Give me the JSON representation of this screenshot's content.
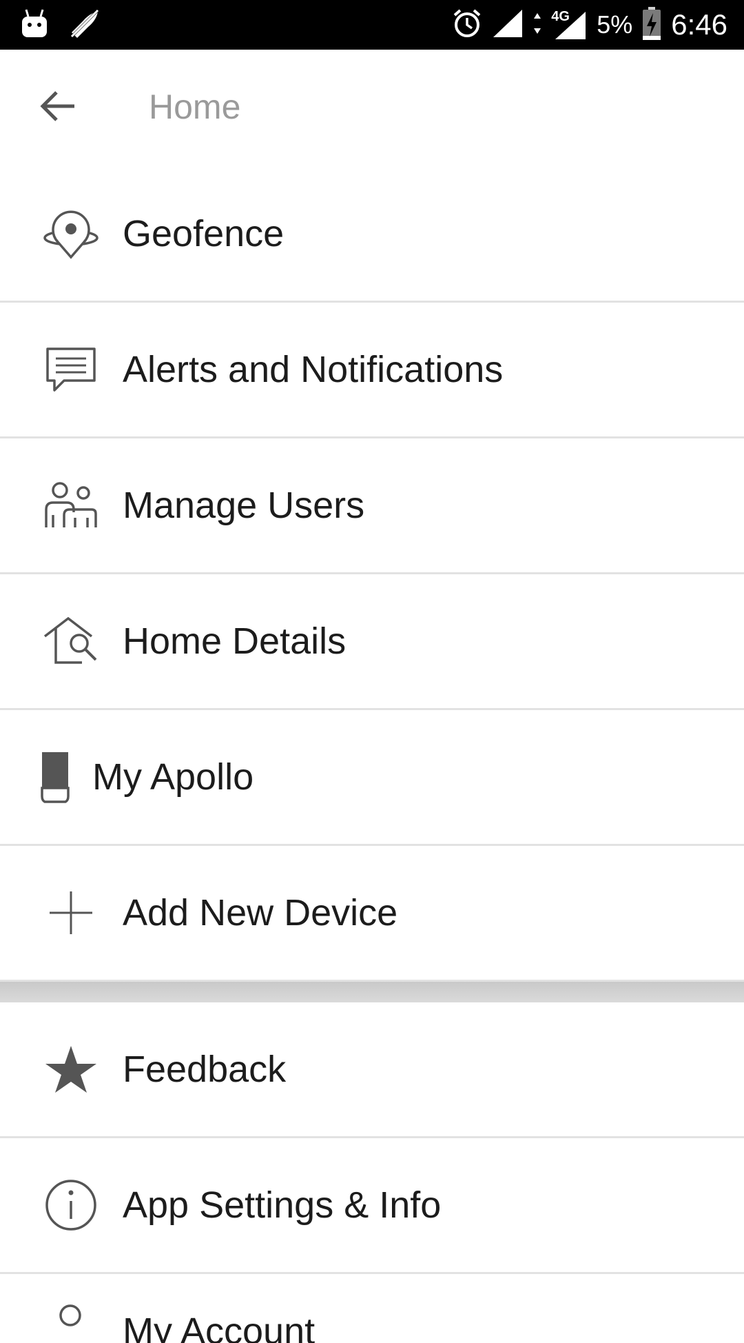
{
  "status_bar": {
    "battery_percent": "5%",
    "time": "6:46",
    "network": "4G",
    "icons": [
      "android-icon",
      "no-location-icon",
      "alarm-icon",
      "signal-icon",
      "data-arrows-icon",
      "signal-4g-icon",
      "battery-charging-icon"
    ]
  },
  "app_bar": {
    "title": "Home",
    "back_icon": "arrow-left-icon"
  },
  "menu": {
    "items": [
      {
        "label": "Geofence",
        "icon": "geofence-pin-icon"
      },
      {
        "label": "Alerts and Notifications",
        "icon": "chat-bubble-icon"
      },
      {
        "label": "Manage Users",
        "icon": "users-icon"
      },
      {
        "label": "Home Details",
        "icon": "home-search-icon"
      },
      {
        "label": "My Apollo",
        "icon": "device-icon"
      },
      {
        "label": "Add New Device",
        "icon": "plus-icon"
      }
    ],
    "secondary_items": [
      {
        "label": "Feedback",
        "icon": "star-icon"
      },
      {
        "label": "App Settings & Info",
        "icon": "info-icon"
      },
      {
        "label": "My Account",
        "icon": "user-icon"
      }
    ]
  },
  "colors": {
    "status_bar_bg": "#000000",
    "title_gray": "#9a9a9a",
    "text": "#1c1c1c",
    "icon": "#555555",
    "divider": "#e2e2e2",
    "section_band": "#d0d0d0"
  }
}
